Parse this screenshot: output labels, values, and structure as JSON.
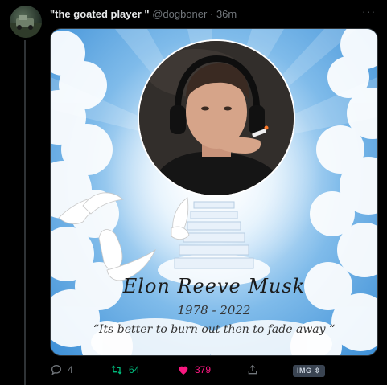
{
  "tweet": {
    "display_name": "\"the goated player \"",
    "handle": "@dogboner",
    "separator": "·",
    "time": "36m",
    "more_label": "···"
  },
  "media": {
    "memorial_name": "Elon Reeve Musk",
    "memorial_dates": "1978 - 2022",
    "memorial_quote": "“Its better to burn out then to fade away “"
  },
  "actions": {
    "reply_count": "4",
    "retweet_count": "64",
    "like_count": "379",
    "img_badge": "IMG ⇳"
  },
  "colors": {
    "background": "#000000",
    "retweet_accent": "#00ba7c",
    "like_accent": "#f91880",
    "muted": "#71767b"
  },
  "icons": [
    "reply-icon",
    "retweet-icon",
    "heart-icon",
    "share-icon",
    "more-icon"
  ]
}
